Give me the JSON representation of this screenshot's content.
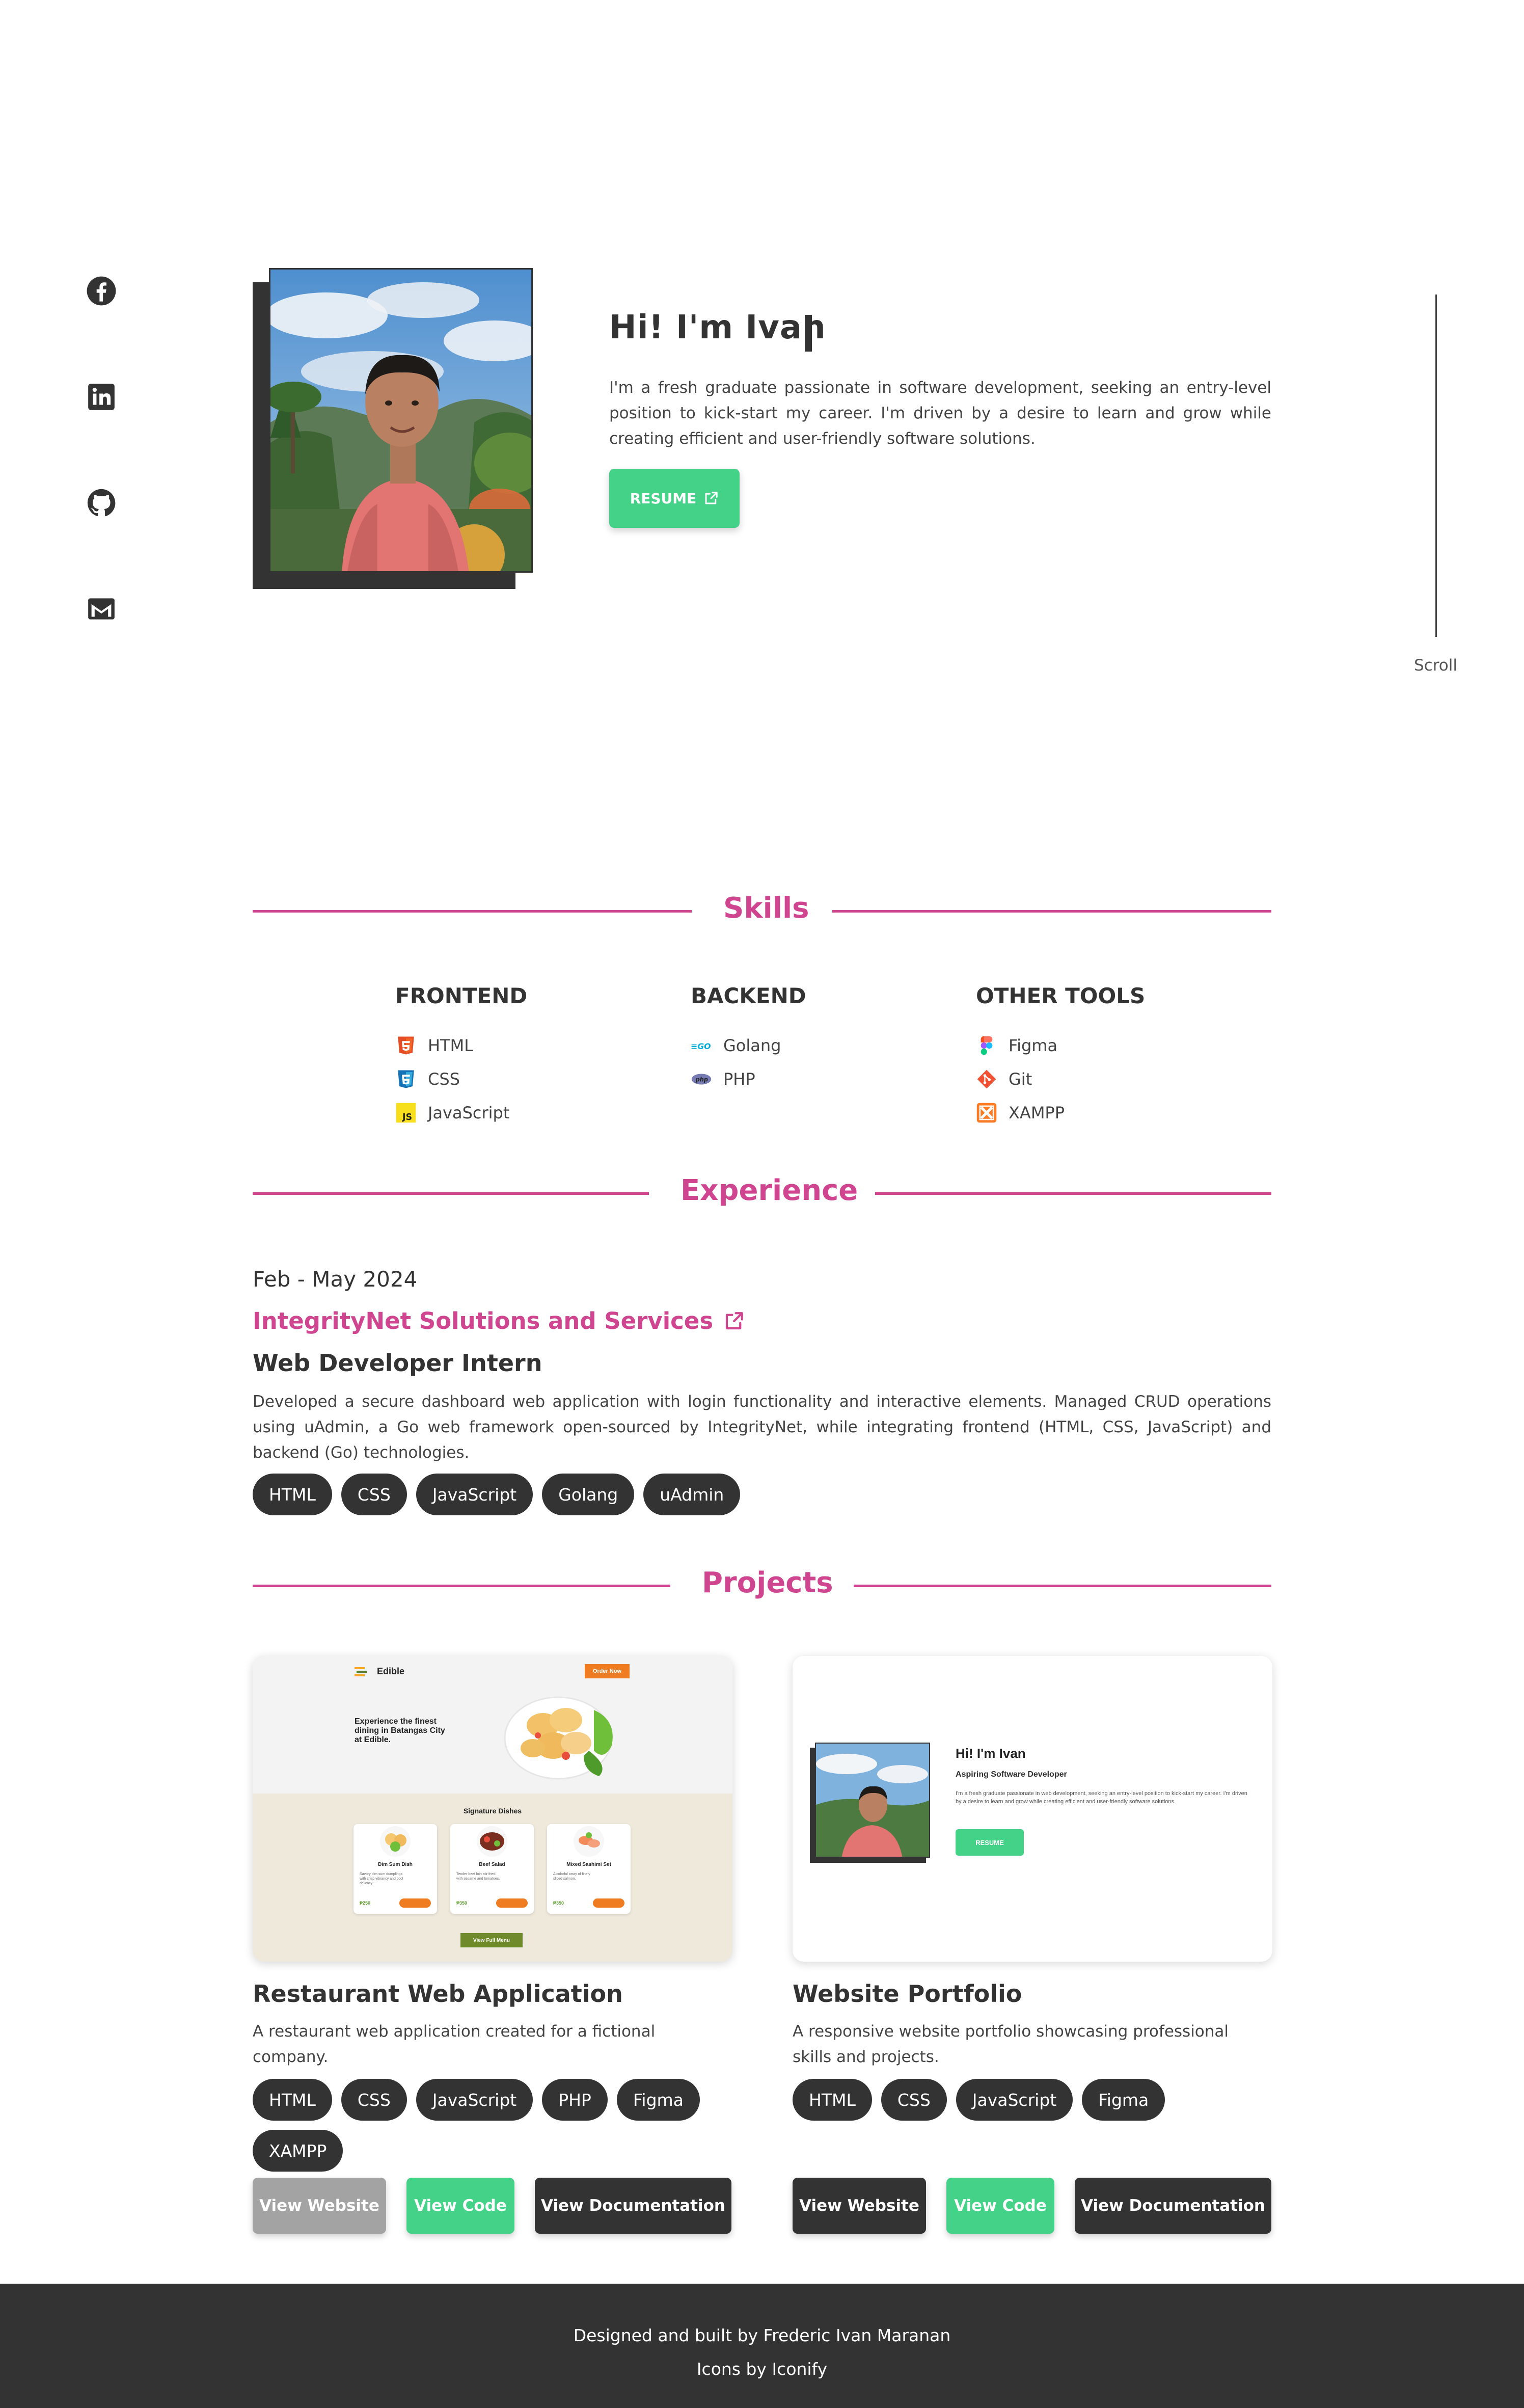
{
  "social": [
    {
      "name": "facebook-icon"
    },
    {
      "name": "linkedin-icon"
    },
    {
      "name": "github-icon"
    },
    {
      "name": "gmail-icon"
    }
  ],
  "hero": {
    "title": "Hi! I'm Ivan",
    "intro": "I'm a fresh graduate passionate in software development, seeking an entry-level position to kick-start my career. I'm driven by a desire to learn and grow while creating efficient and user-friendly software solutions.",
    "resume_label": "RESUME"
  },
  "scroll_label": "Scroll",
  "sections": {
    "skills": "Skills",
    "experience": "Experience",
    "projects": "Projects"
  },
  "skills": {
    "frontend": {
      "title": "FRONTEND",
      "items": [
        "HTML",
        "CSS",
        "JavaScript"
      ]
    },
    "backend": {
      "title": "BACKEND",
      "items": [
        "Golang",
        "PHP"
      ]
    },
    "tools": {
      "title": "OTHER TOOLS",
      "items": [
        "Figma",
        "Git",
        "XAMPP"
      ]
    }
  },
  "experience": {
    "date": "Feb - May 2024",
    "company": "IntegrityNet Solutions and Services",
    "role": "Web Developer Intern",
    "description": "Developed a secure dashboard web application with login functionality and interactive elements. Managed CRUD operations using uAdmin, a Go web framework open-sourced by IntegrityNet, while integrating frontend (HTML, CSS, JavaScript) and backend (Go) technologies.",
    "tags": [
      "HTML",
      "CSS",
      "JavaScript",
      "Golang",
      "uAdmin"
    ]
  },
  "projects": [
    {
      "title": "Restaurant Web Application",
      "description": "A restaurant web application created for a fictional company.",
      "tags": [
        "HTML",
        "CSS",
        "JavaScript",
        "PHP",
        "Figma",
        "XAMPP"
      ],
      "buttons": [
        "View Website",
        "View Code",
        "View Documentation"
      ],
      "thumb": {
        "brand": "Edible",
        "order_btn": "Order Now",
        "headline": "Experience the finest dining in Batangas City at Edible.",
        "section": "Signature Dishes",
        "dishes": [
          {
            "name": "Dim Sum Dish",
            "desc": "Savory dim sum dumplings with crisp vibrancy and cool delicacy.",
            "price": "₱250"
          },
          {
            "name": "Beef Salad",
            "desc": "Tender beef loin stir fried with sesame and tomatoes.",
            "price": "₱350"
          },
          {
            "name": "Mixed Sashimi Set",
            "desc": "A colorful array of finely sliced salmon.",
            "price": "₱350"
          }
        ],
        "menu_btn": "View Full Menu"
      }
    },
    {
      "title": "Website Portfolio",
      "description": "A responsive website portfolio showcasing professional skills and projects.",
      "tags": [
        "HTML",
        "CSS",
        "JavaScript",
        "Figma"
      ],
      "buttons": [
        "View Website",
        "View Code",
        "View Documentation"
      ],
      "thumb": {
        "title": "Hi! I'm Ivan",
        "subtitle": "Aspiring Software Developer",
        "text": "I'm a fresh graduate passionate in web development, seeking an entry-level position to kick-start my career. I'm driven by a desire to learn and grow while creating efficient and user-friendly software solutions.",
        "btn": "RESUME"
      }
    }
  ],
  "footer": {
    "line1": "Designed and built by Frederic Ivan Maranan",
    "line2": "Icons by Iconify"
  },
  "colors": {
    "accent": "#d0458f",
    "green": "#44d188",
    "dark": "#333333"
  }
}
